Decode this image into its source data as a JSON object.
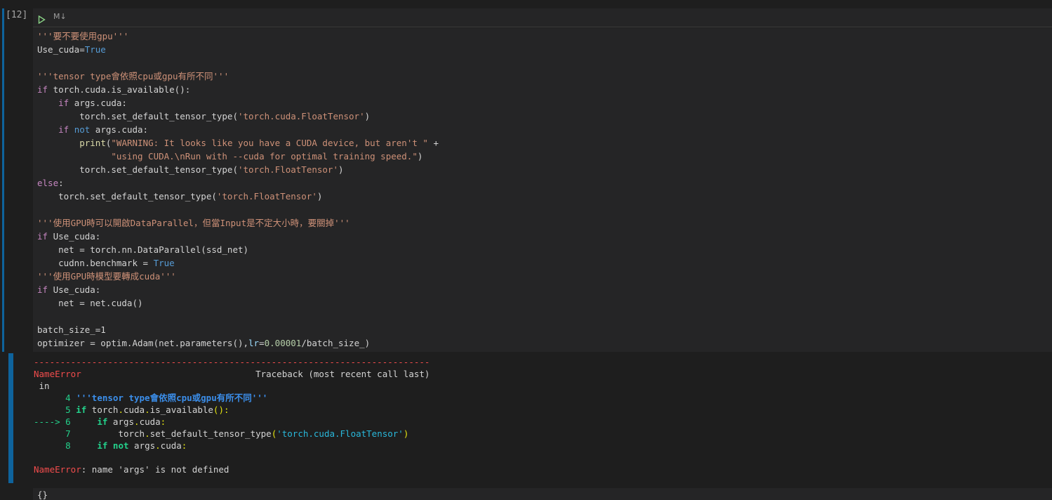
{
  "cell": {
    "execution_count": "[12]",
    "language_label": "M↓",
    "code_lines": [
      [
        {
          "t": "'''要不要使用gpu'''",
          "c": "str"
        }
      ],
      [
        {
          "t": "Use_cuda="
        },
        {
          "t": "True",
          "c": "kwb"
        }
      ],
      [],
      [
        {
          "t": "'''tensor type會依照cpu或gpu有所不同'''",
          "c": "str"
        }
      ],
      [
        {
          "t": "if",
          "c": "kw"
        },
        {
          "t": " torch.cuda.is_available():"
        }
      ],
      [
        {
          "t": "    "
        },
        {
          "t": "if",
          "c": "kw"
        },
        {
          "t": " args.cuda:"
        }
      ],
      [
        {
          "t": "        torch.set_default_tensor_type("
        },
        {
          "t": "'torch.cuda.FloatTensor'",
          "c": "str"
        },
        {
          "t": ")"
        }
      ],
      [
        {
          "t": "    "
        },
        {
          "t": "if",
          "c": "kw"
        },
        {
          "t": " "
        },
        {
          "t": "not",
          "c": "kwb"
        },
        {
          "t": " args.cuda:"
        }
      ],
      [
        {
          "t": "        "
        },
        {
          "t": "print",
          "c": "fn"
        },
        {
          "t": "("
        },
        {
          "t": "\"WARNING: It looks like you have a CUDA device, but aren't \"",
          "c": "str"
        },
        {
          "t": " +"
        }
      ],
      [
        {
          "t": "              "
        },
        {
          "t": "\"using CUDA.\\nRun with --cuda for optimal training speed.\"",
          "c": "str"
        },
        {
          "t": ")"
        }
      ],
      [
        {
          "t": "        torch.set_default_tensor_type("
        },
        {
          "t": "'torch.FloatTensor'",
          "c": "str"
        },
        {
          "t": ")"
        }
      ],
      [
        {
          "t": "else",
          "c": "kw"
        },
        {
          "t": ":"
        }
      ],
      [
        {
          "t": "    torch.set_default_tensor_type("
        },
        {
          "t": "'torch.FloatTensor'",
          "c": "str"
        },
        {
          "t": ")"
        }
      ],
      [],
      [
        {
          "t": "'''使用GPU時可以開啟DataParallel，但當Input是不定大小時，要關掉'''",
          "c": "str"
        }
      ],
      [
        {
          "t": "if",
          "c": "kw"
        },
        {
          "t": " Use_cuda:"
        }
      ],
      [
        {
          "t": "    net = torch.nn.DataParallel(ssd_net)"
        }
      ],
      [
        {
          "t": "    cudnn.benchmark = "
        },
        {
          "t": "True",
          "c": "kwb"
        }
      ],
      [
        {
          "t": "'''使用GPU時模型要轉成cuda'''",
          "c": "str"
        }
      ],
      [
        {
          "t": "if",
          "c": "kw"
        },
        {
          "t": " Use_cuda:"
        }
      ],
      [
        {
          "t": "    net = net.cuda()"
        }
      ],
      [],
      [
        {
          "t": "batch_size_=1"
        }
      ],
      [
        {
          "t": "optimizer = optim.Adam(net.parameters(),"
        },
        {
          "t": "lr",
          "c": "param"
        },
        {
          "t": "="
        },
        {
          "t": "0.00001",
          "c": "num"
        },
        {
          "t": "/batch_size_)"
        }
      ]
    ]
  },
  "output": {
    "lines": [
      [
        {
          "t": "---------------------------------------------------------------------------",
          "c": "err"
        }
      ],
      [
        {
          "t": "NameError",
          "c": "err"
        },
        {
          "t": "                                 Traceback (most recent call last)"
        }
      ],
      [
        {
          "t": " in"
        }
      ],
      [
        {
          "t": "      4 ",
          "c": "grn"
        },
        {
          "t": "'''tensor type會依照cpu或gpu有所不同'''",
          "c": "blu bld"
        }
      ],
      [
        {
          "t": "      5 ",
          "c": "grn"
        },
        {
          "t": "if",
          "c": "grn bld"
        },
        {
          "t": " torch"
        },
        {
          "t": ".",
          "c": "yel"
        },
        {
          "t": "cuda"
        },
        {
          "t": ".",
          "c": "yel"
        },
        {
          "t": "is_available"
        },
        {
          "t": "():",
          "c": "yel"
        }
      ],
      [
        {
          "t": "----> 6 ",
          "c": "grn"
        },
        {
          "t": "    "
        },
        {
          "t": "if",
          "c": "grn bld"
        },
        {
          "t": " args"
        },
        {
          "t": ".",
          "c": "yel"
        },
        {
          "t": "cuda"
        },
        {
          "t": ":",
          "c": "yel"
        }
      ],
      [
        {
          "t": "      7 ",
          "c": "grn"
        },
        {
          "t": "        torch"
        },
        {
          "t": ".",
          "c": "yel"
        },
        {
          "t": "set_default_tensor_type"
        },
        {
          "t": "(",
          "c": "yel"
        },
        {
          "t": "'torch.cuda.FloatTensor'",
          "c": "cyn"
        },
        {
          "t": ")",
          "c": "yel"
        }
      ],
      [
        {
          "t": "      8 ",
          "c": "grn"
        },
        {
          "t": "    "
        },
        {
          "t": "if",
          "c": "grn bld"
        },
        {
          "t": " "
        },
        {
          "t": "not",
          "c": "grn bld"
        },
        {
          "t": " args"
        },
        {
          "t": ".",
          "c": "yel"
        },
        {
          "t": "cuda"
        },
        {
          "t": ":",
          "c": "yel"
        }
      ],
      [],
      [
        {
          "t": "NameError",
          "c": "err"
        },
        {
          "t": ": name 'args' is not defined"
        }
      ]
    ]
  },
  "next_cell": {
    "code": "{}"
  },
  "colors": {
    "background": "#1e1e1e",
    "cell_background": "#252526",
    "focus_bar": "#0e639c",
    "error_red": "#f14c4c"
  }
}
